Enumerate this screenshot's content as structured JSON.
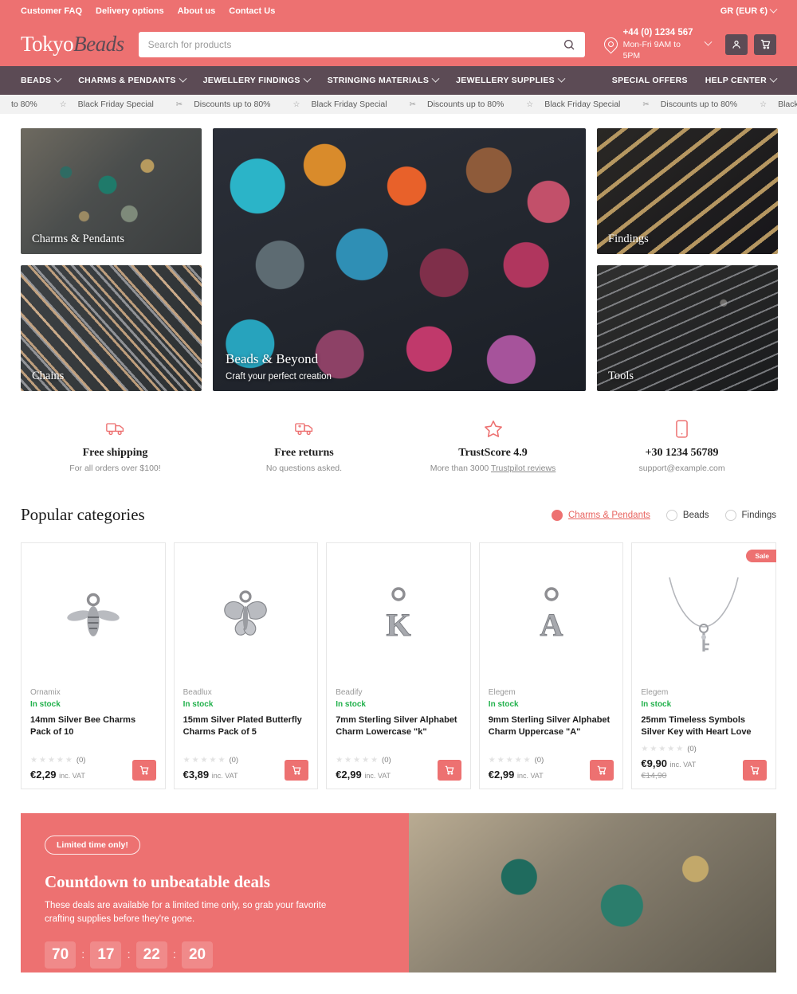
{
  "topbar": {
    "links": [
      "Customer FAQ",
      "Delivery options",
      "About us",
      "Contact Us"
    ],
    "locale": "GR (EUR €)"
  },
  "header": {
    "logo_main": "Tokyo",
    "logo_accent": "Beads",
    "search_placeholder": "Search for products",
    "phone": "+44 (0) 1234 567",
    "hours": "Mon-Fri 9AM to 5PM"
  },
  "nav": {
    "items": [
      "BEADS",
      "CHARMS & PENDANTS",
      "JEWELLERY FINDINGS",
      "STRINGING MATERIALS",
      "JEWELLERY SUPPLIES"
    ],
    "right_items": [
      "SPECIAL OFFERS",
      "HELP CENTER"
    ]
  },
  "marquee": {
    "discount_text": "Discounts up to 80%",
    "friday_text": "Black Friday Special",
    "lead_text": "to 80%"
  },
  "hero": {
    "tiles": [
      {
        "caption": "Charms & Pendants"
      },
      {
        "caption": "Chains"
      },
      {
        "caption": "Beads & Beyond",
        "subtitle": "Craft your perfect creation"
      },
      {
        "caption": "Findings"
      },
      {
        "caption": "Tools"
      }
    ]
  },
  "features": [
    {
      "icon": "truck-icon",
      "title": "Free shipping",
      "sub": "For all orders over $100!"
    },
    {
      "icon": "return-truck-icon",
      "title": "Free returns",
      "sub": "No questions asked."
    },
    {
      "icon": "star-icon",
      "title": "TrustScore 4.9",
      "sub_pre": "More than 3000 ",
      "sub_link": "Trustpilot reviews"
    },
    {
      "icon": "phone-icon",
      "title": "+30 1234 56789",
      "sub": "support@example.com"
    }
  ],
  "popular": {
    "title": "Popular categories",
    "filters": [
      {
        "label": "Charms & Pendants",
        "selected": true
      },
      {
        "label": "Beads",
        "selected": false
      },
      {
        "label": "Findings",
        "selected": false
      }
    ]
  },
  "products": [
    {
      "brand": "Ornamix",
      "stock": "In stock",
      "name": "14mm Silver Bee Charms Pack of 10",
      "rating_count": "(0)",
      "price": "€2,29",
      "vat": "inc. VAT",
      "old_price": "",
      "badge": ""
    },
    {
      "brand": "Beadlux",
      "stock": "In stock",
      "name": "15mm Silver Plated Butterfly Charms Pack of 5",
      "rating_count": "(0)",
      "price": "€3,89",
      "vat": "inc. VAT",
      "old_price": "",
      "badge": ""
    },
    {
      "brand": "Beadify",
      "stock": "In stock",
      "name": "7mm Sterling Silver Alphabet Charm Lowercase \"k\"",
      "rating_count": "(0)",
      "price": "€2,99",
      "vat": "inc. VAT",
      "old_price": "",
      "badge": ""
    },
    {
      "brand": "Elegem",
      "stock": "In stock",
      "name": "9mm Sterling Silver Alphabet Charm Uppercase \"A\"",
      "rating_count": "(0)",
      "price": "€2,99",
      "vat": "inc. VAT",
      "old_price": "",
      "badge": ""
    },
    {
      "brand": "Elegem",
      "stock": "In stock",
      "name": "25mm Timeless Symbols Silver Key with Heart Love",
      "rating_count": "(0)",
      "price": "€9,90",
      "vat": "inc. VAT",
      "old_price": "€14,90",
      "badge": "Sale"
    }
  ],
  "banner": {
    "pill": "Limited time only!",
    "title": "Countdown to unbeatable deals",
    "subtitle": "These deals are available for a limited time only, so grab your favorite crafting supplies before they're gone.",
    "countdown": [
      "70",
      "17",
      "22",
      "20"
    ],
    "separator": ":"
  },
  "colors": {
    "accent": "#ED7171",
    "nav": "#5C4B55",
    "stock": "#22b14c",
    "marquee_bg": "#F2F2F2"
  }
}
